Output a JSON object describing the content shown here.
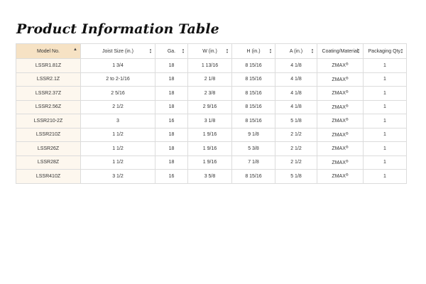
{
  "page": {
    "title": "Product Information Table"
  },
  "table": {
    "columns": [
      {
        "label": "Model No.",
        "sort": "asc"
      },
      {
        "label": "Joist Size (in.)",
        "sort": "both"
      },
      {
        "label": "Ga.",
        "sort": "both"
      },
      {
        "label": "W (in.)",
        "sort": "both"
      },
      {
        "label": "H (in.)",
        "sort": "both"
      },
      {
        "label": "A (in.)",
        "sort": "both"
      },
      {
        "label": "Coating/Material",
        "sort": "both"
      },
      {
        "label": "Packaging Qty.",
        "sort": "both"
      }
    ],
    "rows": [
      {
        "model": "LSSR1.81Z",
        "joist": "1 3/4",
        "ga": "18",
        "w": "1 13/16",
        "h": "8 15/16",
        "a": "4 1/8",
        "coating": "ZMAX",
        "coating_mark": "®",
        "qty": "1"
      },
      {
        "model": "LSSR2.1Z",
        "joist": "2 to 2-1/16",
        "ga": "18",
        "w": "2 1/8",
        "h": "8 15/16",
        "a": "4 1/8",
        "coating": "ZMAX",
        "coating_mark": "®",
        "qty": "1"
      },
      {
        "model": "LSSR2.37Z",
        "joist": "2 5/16",
        "ga": "18",
        "w": "2 3/8",
        "h": "8 15/16",
        "a": "4 1/8",
        "coating": "ZMAX",
        "coating_mark": "®",
        "qty": "1"
      },
      {
        "model": "LSSR2.56Z",
        "joist": "2 1/2",
        "ga": "18",
        "w": "2 9/16",
        "h": "8 15/16",
        "a": "4 1/8",
        "coating": "ZMAX",
        "coating_mark": "®",
        "qty": "1"
      },
      {
        "model": "LSSR210-2Z",
        "joist": "3",
        "ga": "16",
        "w": "3 1/8",
        "h": "8 15/16",
        "a": "5 1/8",
        "coating": "ZMAX",
        "coating_mark": "®",
        "qty": "1"
      },
      {
        "model": "LSSR210Z",
        "joist": "1 1/2",
        "ga": "18",
        "w": "1 9/16",
        "h": "9 1/8",
        "a": "2 1/2",
        "coating": "ZMAX",
        "coating_mark": "®",
        "qty": "1"
      },
      {
        "model": "LSSR26Z",
        "joist": "1 1/2",
        "ga": "18",
        "w": "1 9/16",
        "h": "5 3/8",
        "a": "2 1/2",
        "coating": "ZMAX",
        "coating_mark": "®",
        "qty": "1"
      },
      {
        "model": "LSSR28Z",
        "joist": "1 1/2",
        "ga": "18",
        "w": "1 9/16",
        "h": "7 1/8",
        "a": "2 1/2",
        "coating": "ZMAX",
        "coating_mark": "®",
        "qty": "1"
      },
      {
        "model": "LSSR410Z",
        "joist": "3 1/2",
        "ga": "16",
        "w": "3 5/8",
        "h": "8 15/16",
        "a": "5 1/8",
        "coating": "ZMAX",
        "coating_mark": "®",
        "qty": "1"
      }
    ]
  }
}
